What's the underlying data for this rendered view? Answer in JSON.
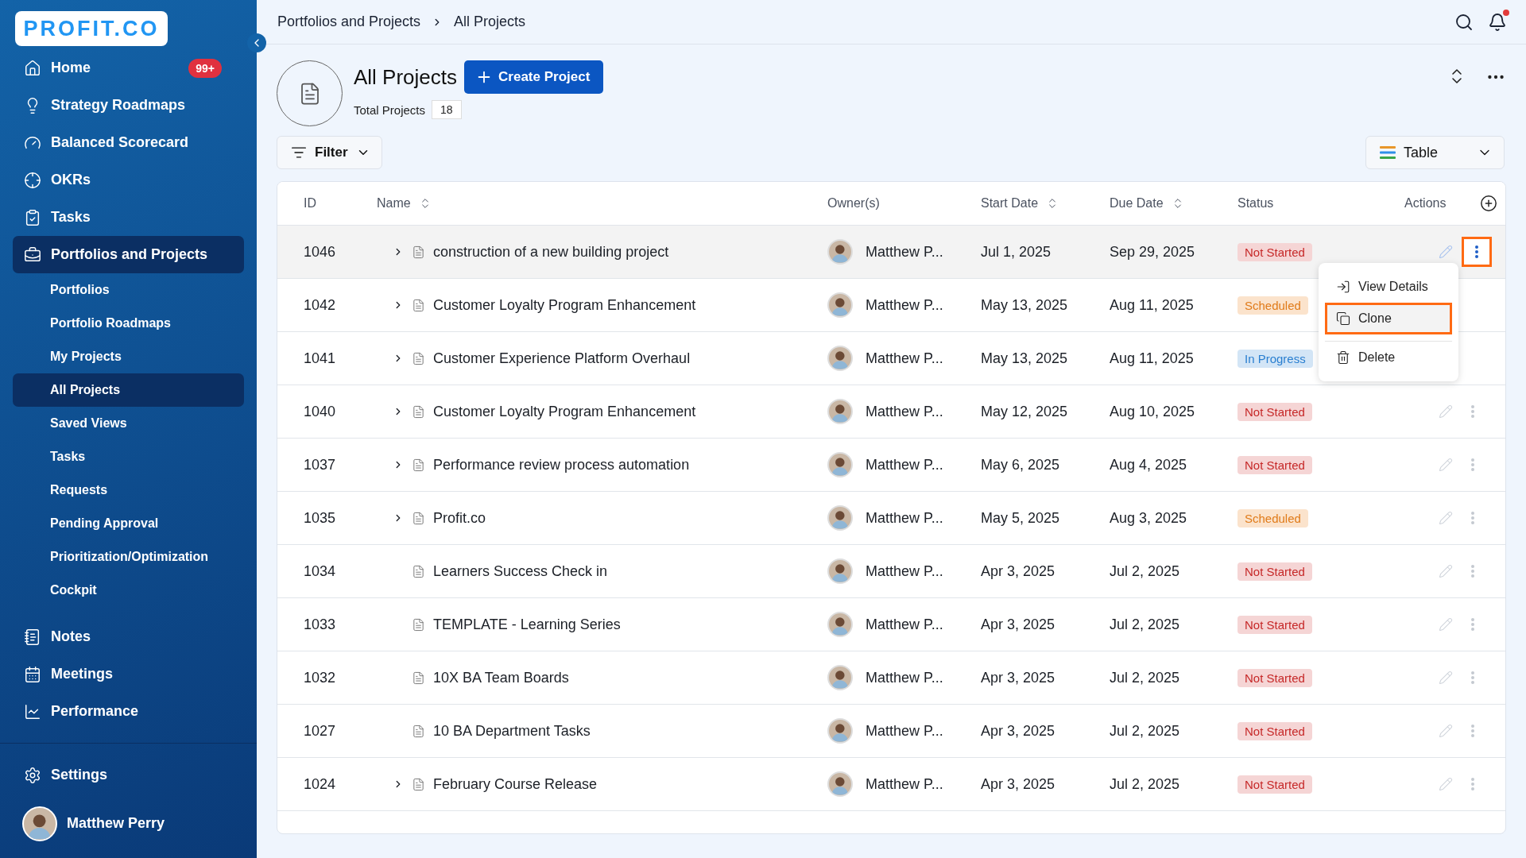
{
  "sidebar": {
    "logo": "PROFIT.CO",
    "items": [
      {
        "label": "Home",
        "kind": "main",
        "badge": "99+",
        "selected": false
      },
      {
        "label": "Strategy Roadmaps",
        "kind": "main",
        "selected": false
      },
      {
        "label": "Balanced Scorecard",
        "kind": "main",
        "selected": false
      },
      {
        "label": "OKRs",
        "kind": "main",
        "selected": false
      },
      {
        "label": "Tasks",
        "kind": "main",
        "selected": false
      },
      {
        "label": "Portfolios and Projects",
        "kind": "main",
        "selected": true
      },
      {
        "label": "Portfolios",
        "kind": "sub",
        "selected": false
      },
      {
        "label": "Portfolio Roadmaps",
        "kind": "sub",
        "selected": false
      },
      {
        "label": "My Projects",
        "kind": "sub",
        "selected": false
      },
      {
        "label": "All Projects",
        "kind": "sub",
        "selected": true
      },
      {
        "label": "Saved Views",
        "kind": "sub",
        "selected": false
      },
      {
        "label": "Tasks",
        "kind": "sub",
        "selected": false
      },
      {
        "label": "Requests",
        "kind": "sub",
        "selected": false
      },
      {
        "label": "Pending Approval",
        "kind": "sub",
        "selected": false
      },
      {
        "label": "Prioritization/Optimization",
        "kind": "sub",
        "selected": false
      },
      {
        "label": "Cockpit",
        "kind": "sub",
        "selected": false
      },
      {
        "label": "Notes",
        "kind": "main",
        "selected": false
      },
      {
        "label": "Meetings",
        "kind": "main",
        "selected": false
      },
      {
        "label": "Performance",
        "kind": "main",
        "selected": false
      }
    ],
    "settings": "Settings",
    "user": "Matthew Perry"
  },
  "breadcrumb": [
    "Portfolios and Projects",
    "All Projects"
  ],
  "notifications": {
    "unread": true
  },
  "page": {
    "title": "All Projects",
    "create_button": "Create Project",
    "total_label": "Total Projects",
    "total": "18"
  },
  "filter": "Filter",
  "view_select": "Table",
  "table": {
    "columns": [
      {
        "label": "ID",
        "sortable": false
      },
      {
        "label": "Name",
        "sortable": true
      },
      {
        "label": "Owner(s)",
        "sortable": false
      },
      {
        "label": "Start Date",
        "sortable": true
      },
      {
        "label": "Due Date",
        "sortable": true
      },
      {
        "label": "Status",
        "sortable": false
      },
      {
        "label": "Actions",
        "sortable": false
      }
    ],
    "rows": [
      {
        "id": "1046",
        "name": "construction of a new building project",
        "expandable": true,
        "owner": "Matthew P...",
        "start": "Jul 1, 2025",
        "due": "Sep 29, 2025",
        "status": {
          "label": "Not Started",
          "kind": "not_started"
        },
        "menu_open": true
      },
      {
        "id": "1042",
        "name": "Customer Loyalty Program Enhancement",
        "expandable": true,
        "owner": "Matthew P...",
        "start": "May 13, 2025",
        "due": "Aug 11, 2025",
        "status": {
          "label": "Scheduled",
          "kind": "scheduled"
        },
        "menu_open": false
      },
      {
        "id": "1041",
        "name": "Customer Experience Platform Overhaul",
        "expandable": true,
        "owner": "Matthew P...",
        "start": "May 13, 2025",
        "due": "Aug 11, 2025",
        "status": {
          "label": "In Progress",
          "kind": "in_progress"
        },
        "menu_open": false
      },
      {
        "id": "1040",
        "name": "Customer Loyalty Program Enhancement",
        "expandable": true,
        "owner": "Matthew P...",
        "start": "May 12, 2025",
        "due": "Aug 10, 2025",
        "status": {
          "label": "Not Started",
          "kind": "not_started"
        },
        "menu_open": false
      },
      {
        "id": "1037",
        "name": "Performance review process automation",
        "expandable": true,
        "owner": "Matthew P...",
        "start": "May 6, 2025",
        "due": "Aug 4, 2025",
        "status": {
          "label": "Not Started",
          "kind": "not_started"
        },
        "menu_open": false
      },
      {
        "id": "1035",
        "name": "Profit.co",
        "expandable": true,
        "owner": "Matthew P...",
        "start": "May 5, 2025",
        "due": "Aug 3, 2025",
        "status": {
          "label": "Scheduled",
          "kind": "scheduled"
        },
        "menu_open": false
      },
      {
        "id": "1034",
        "name": "Learners Success Check in",
        "expandable": false,
        "owner": "Matthew P...",
        "start": "Apr 3, 2025",
        "due": "Jul 2, 2025",
        "status": {
          "label": "Not Started",
          "kind": "not_started"
        },
        "menu_open": false
      },
      {
        "id": "1033",
        "name": "TEMPLATE - Learning Series",
        "expandable": false,
        "owner": "Matthew P...",
        "start": "Apr 3, 2025",
        "due": "Jul 2, 2025",
        "status": {
          "label": "Not Started",
          "kind": "not_started"
        },
        "menu_open": false
      },
      {
        "id": "1032",
        "name": "10X BA Team Boards",
        "expandable": false,
        "owner": "Matthew P...",
        "start": "Apr 3, 2025",
        "due": "Jul 2, 2025",
        "status": {
          "label": "Not Started",
          "kind": "not_started"
        },
        "menu_open": false
      },
      {
        "id": "1027",
        "name": "10 BA Department Tasks",
        "expandable": false,
        "owner": "Matthew P...",
        "start": "Apr 3, 2025",
        "due": "Jul 2, 2025",
        "status": {
          "label": "Not Started",
          "kind": "not_started"
        },
        "menu_open": false
      },
      {
        "id": "1024",
        "name": "February Course Release",
        "expandable": true,
        "owner": "Matthew P...",
        "start": "Apr 3, 2025",
        "due": "Jul 2, 2025",
        "status": {
          "label": "Not Started",
          "kind": "not_started"
        },
        "menu_open": false
      }
    ]
  },
  "row_menu": [
    {
      "label": "View Details",
      "selected": false
    },
    {
      "label": "Clone",
      "selected": true
    },
    {
      "label": "Delete",
      "selected": false
    }
  ]
}
